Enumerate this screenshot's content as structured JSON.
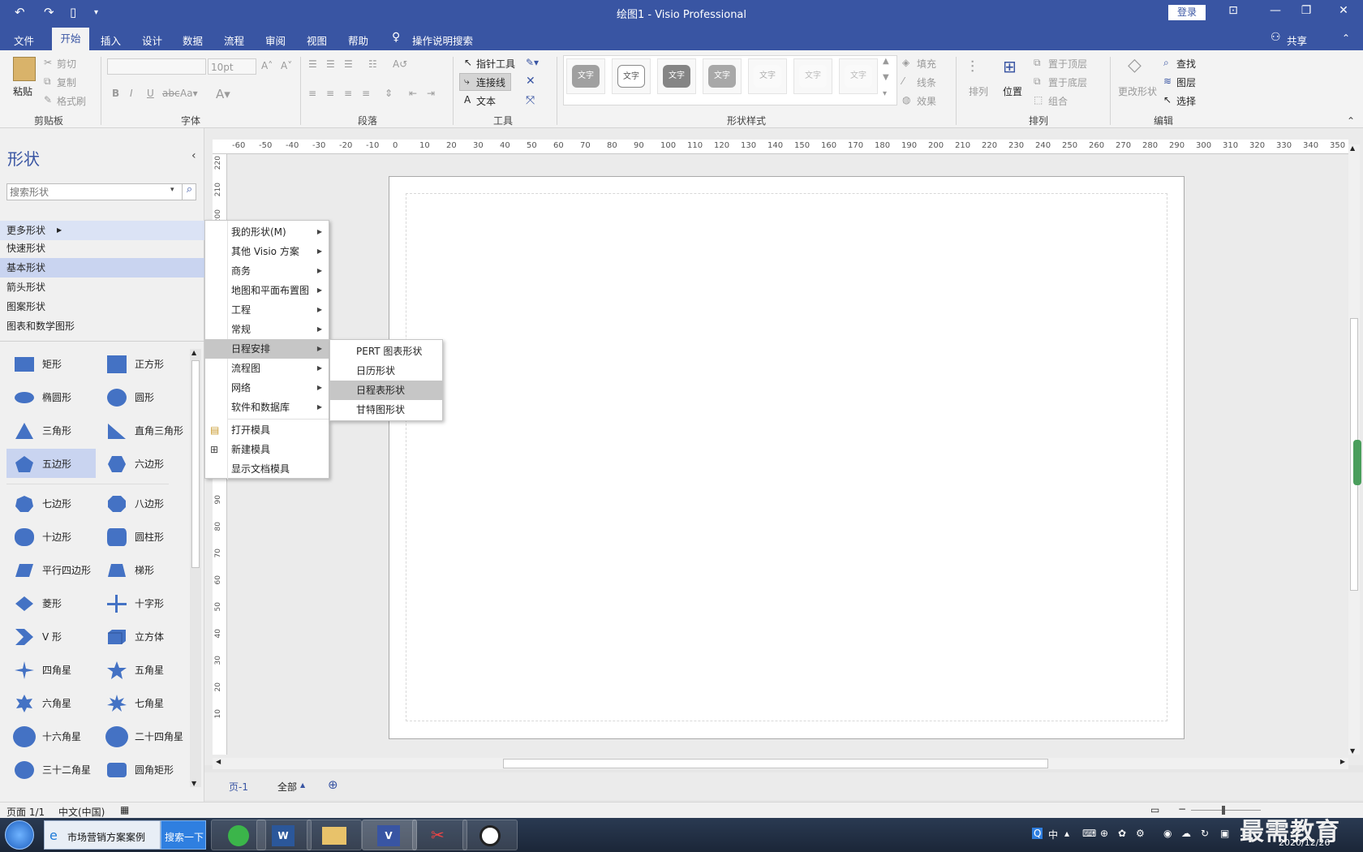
{
  "title_bar": {
    "title": "绘图1  -  Visio Professional",
    "login_label": "登录"
  },
  "menu": {
    "items": [
      "文件",
      "开始",
      "插入",
      "设计",
      "数据",
      "流程",
      "审阅",
      "视图",
      "帮助"
    ],
    "tell_me": "操作说明搜索",
    "share": "共享"
  },
  "ribbon": {
    "clipboard": {
      "paste": "粘贴",
      "cut": "剪切",
      "copy": "复制",
      "format_painter": "格式刷",
      "label": "剪贴板"
    },
    "font": {
      "size": "10pt",
      "label": "字体"
    },
    "paragraph": {
      "label": "段落"
    },
    "tools": {
      "pointer": "指针工具",
      "connector": "连接线",
      "text": "文本",
      "label": "工具"
    },
    "shape_styles": {
      "tiles": [
        "文字",
        "文字",
        "文字",
        "文字",
        "文字",
        "文字",
        "文字"
      ],
      "fill": "填充",
      "line": "线条",
      "effect": "效果",
      "label": "形状样式"
    },
    "arrange": {
      "align": "排列",
      "position": "位置",
      "bring_front": "置于顶层",
      "send_back": "置于底层",
      "group": "组合",
      "label": "排列"
    },
    "editing": {
      "change_shape": "更改形状",
      "find": "查找",
      "layers": "图层",
      "select": "选择",
      "label": "编辑"
    }
  },
  "shapes_pane": {
    "title": "形状",
    "search_placeholder": "搜索形状",
    "stencils": [
      "更多形状",
      "快速形状",
      "基本形状",
      "箭头形状",
      "图案形状",
      "图表和数学图形"
    ],
    "shapes": [
      "矩形",
      "正方形",
      "椭圆形",
      "圆形",
      "三角形",
      "直角三角形",
      "五边形",
      "六边形",
      "七边形",
      "八边形",
      "十边形",
      "圆柱形",
      "平行四边形",
      "梯形",
      "菱形",
      "十字形",
      "V 形",
      "立方体",
      "四角星",
      "五角星",
      "六角星",
      "七角星",
      "十六角星",
      "二十四角星",
      "三十二角星",
      "圆角矩形"
    ]
  },
  "ruler": {
    "h_ticks": [
      "-60",
      "-50",
      "-40",
      "-30",
      "-20",
      "-10",
      "0",
      "10",
      "20",
      "30",
      "40",
      "50",
      "60",
      "70",
      "80",
      "90",
      "100",
      "110",
      "120",
      "130",
      "140",
      "150",
      "160",
      "170",
      "180",
      "190",
      "200",
      "210",
      "220",
      "230",
      "240",
      "250",
      "260",
      "270",
      "280",
      "290",
      "300",
      "310",
      "320",
      "330",
      "340",
      "350"
    ],
    "v_ticks": [
      "220",
      "210",
      "200",
      "90",
      "80",
      "70",
      "60",
      "50",
      "40",
      "30",
      "20",
      "10"
    ]
  },
  "more_shapes_menu": {
    "items": [
      "我的形状(M)",
      "其他 Visio 方案",
      "商务",
      "地图和平面布置图",
      "工程",
      "常规",
      "日程安排",
      "流程图",
      "网络",
      "软件和数据库"
    ],
    "actions": [
      "打开模具",
      "新建模具",
      "显示文档模具"
    ]
  },
  "schedule_submenu": {
    "items": [
      "PERT 图表形状",
      "日历形状",
      "日程表形状",
      "甘特图形状"
    ]
  },
  "page_tabs": {
    "page": "页-1",
    "all": "全部"
  },
  "status_bar": {
    "page": "页面 1/1",
    "language": "中文(中国)"
  },
  "taskbar": {
    "browser_title": "市场营销方案案例",
    "search_btn": "搜索一下",
    "ime": "中",
    "date": "2020/12/26",
    "watermark": "最需教育"
  },
  "colors": {
    "accent": "#3955a3",
    "shape_fill": "#4472c4"
  }
}
